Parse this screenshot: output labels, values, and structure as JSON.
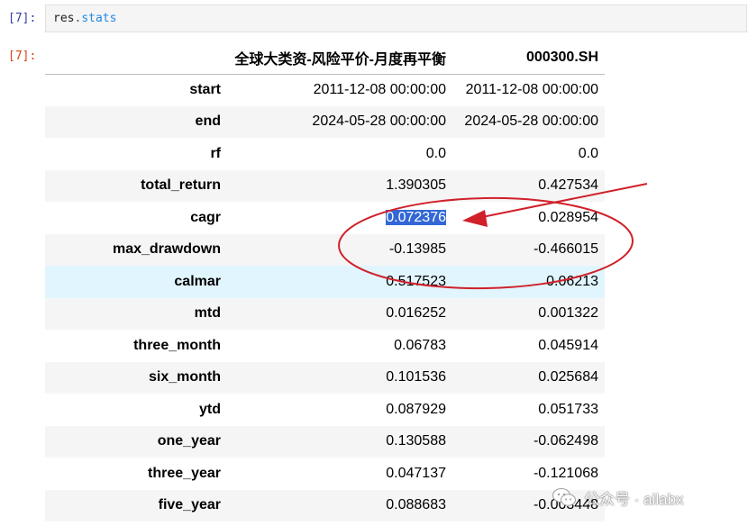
{
  "input": {
    "prompt": "[7]:",
    "code_obj": "res",
    "code_dot": ".",
    "code_attr": "stats"
  },
  "output": {
    "prompt": "[7]:",
    "columns": [
      "",
      "全球大类资-风险平价-月度再平衡",
      "000300.SH"
    ],
    "rows": [
      {
        "label": "start",
        "a": "2011-12-08 00:00:00",
        "b": "2011-12-08 00:00:00"
      },
      {
        "label": "end",
        "a": "2024-05-28 00:00:00",
        "b": "2024-05-28 00:00:00"
      },
      {
        "label": "rf",
        "a": "0.0",
        "b": "0.0"
      },
      {
        "label": "total_return",
        "a": "1.390305",
        "b": "0.427534"
      },
      {
        "label": "cagr",
        "a": "0.072376",
        "b": "0.028954"
      },
      {
        "label": "max_drawdown",
        "a": "-0.13985",
        "b": "-0.466015"
      },
      {
        "label": "calmar",
        "a": "0.517523",
        "b": "0.06213"
      },
      {
        "label": "mtd",
        "a": "0.016252",
        "b": "0.001322"
      },
      {
        "label": "three_month",
        "a": "0.06783",
        "b": "0.045914"
      },
      {
        "label": "six_month",
        "a": "0.101536",
        "b": "0.025684"
      },
      {
        "label": "ytd",
        "a": "0.087929",
        "b": "0.051733"
      },
      {
        "label": "one_year",
        "a": "0.130588",
        "b": "-0.062498"
      },
      {
        "label": "three_year",
        "a": "0.047137",
        "b": "-0.121068"
      },
      {
        "label": "five_year",
        "a": "0.088683",
        "b": "-0.003448"
      }
    ],
    "selected_cell": "cagr",
    "hovered_row": "calmar"
  },
  "annotation": {
    "color": "#d0202a",
    "shapes": [
      "ellipse",
      "arrow"
    ]
  },
  "watermark": {
    "text": "公众号 · ailabx",
    "icon": "wechat-icon"
  },
  "colors": {
    "prompt_in": "#303f9f",
    "prompt_out": "#d84315",
    "selection": "#3367d6",
    "row_stripe": "#f5f5f5",
    "row_hover": "#e1f5fe"
  }
}
